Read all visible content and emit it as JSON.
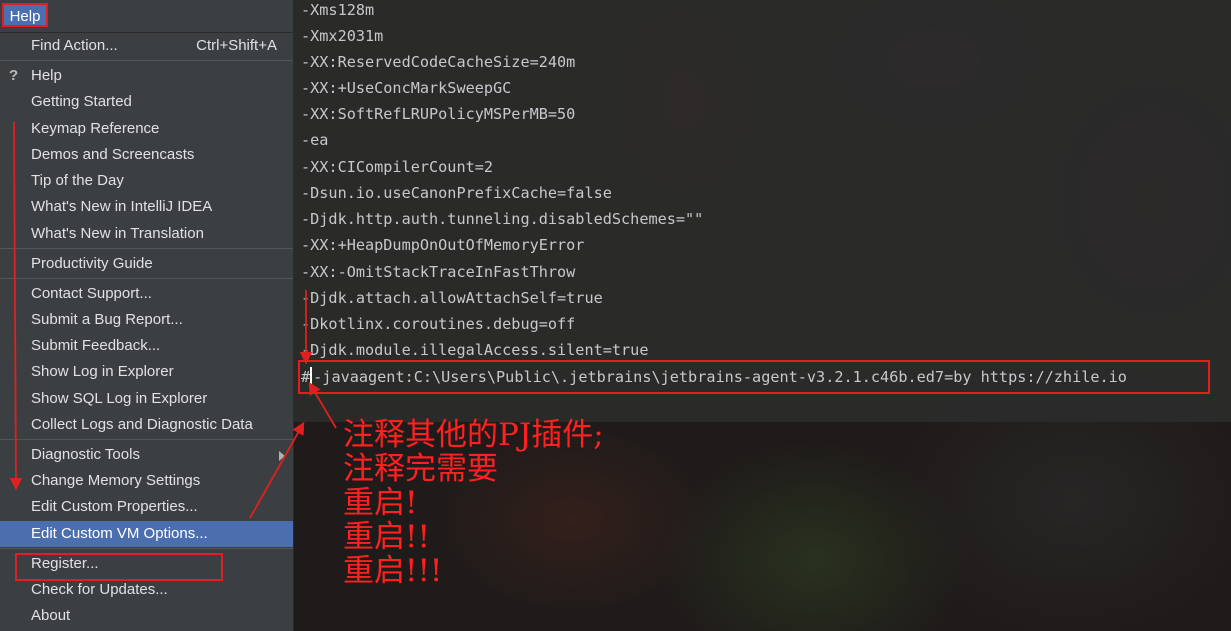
{
  "menubar": {
    "help_label": "Help"
  },
  "menu": {
    "items": [
      {
        "label": "Find Action...",
        "shortcut": "Ctrl+Shift+A"
      },
      {
        "label": "Help"
      },
      {
        "label": "Getting Started"
      },
      {
        "label": "Keymap Reference"
      },
      {
        "label": "Demos and Screencasts"
      },
      {
        "label": "Tip of the Day"
      },
      {
        "label": "What's New in IntelliJ IDEA"
      },
      {
        "label": "What's New in Translation"
      },
      {
        "label": "Productivity Guide"
      },
      {
        "label": "Contact Support..."
      },
      {
        "label": "Submit a Bug Report..."
      },
      {
        "label": "Submit Feedback..."
      },
      {
        "label": "Show Log in Explorer"
      },
      {
        "label": "Show SQL Log in Explorer"
      },
      {
        "label": "Collect Logs and Diagnostic Data"
      },
      {
        "label": "Diagnostic Tools"
      },
      {
        "label": "Change Memory Settings"
      },
      {
        "label": "Edit Custom Properties..."
      },
      {
        "label": "Edit Custom VM Options..."
      },
      {
        "label": "Register..."
      },
      {
        "label": "Check for Updates..."
      },
      {
        "label": "About"
      }
    ],
    "help_icon": "?"
  },
  "editor": {
    "lines": [
      "-Xms128m",
      "-Xmx2031m",
      "-XX:ReservedCodeCacheSize=240m",
      "-XX:+UseConcMarkSweepGC",
      "-XX:SoftRefLRUPolicyMSPerMB=50",
      "-ea",
      "-XX:CICompilerCount=2",
      "-Dsun.io.useCanonPrefixCache=false",
      "-Djdk.http.auth.tunneling.disabledSchemes=\"\"",
      "-XX:+HeapDumpOnOutOfMemoryError",
      "-XX:-OmitStackTraceInFastThrow",
      "-Djdk.attach.allowAttachSelf=true",
      "-Dkotlinx.coroutines.debug=off",
      "-Djdk.module.illegalAccess.silent=true"
    ],
    "agent_hash": "#",
    "agent_line": "-javaagent:C:\\Users\\Public\\.jetbrains\\jetbrains-agent-v3.2.1.c46b.ed7=by https://zhile.io"
  },
  "annotation": {
    "lines": [
      "注释其他的PJ插件;",
      "注释完需要",
      "重启!",
      "重启!!",
      "重启!!!"
    ]
  },
  "colors": {
    "annotation_red": "#e02020",
    "menu_bg": "#3c3f41",
    "selection_blue": "#4b6eaf"
  }
}
